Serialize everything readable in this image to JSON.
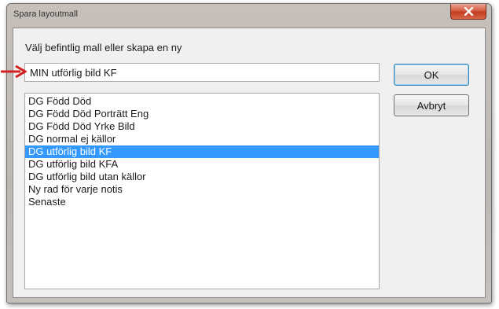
{
  "window": {
    "title": "Spara layoutmall"
  },
  "dialog": {
    "prompt": "Välj befintlig mall eller skapa en ny",
    "name_value": "MIN utförlig bild KF",
    "ok_label": "OK",
    "cancel_label": "Avbryt"
  },
  "templates": [
    {
      "label": "DG Född Död",
      "selected": false
    },
    {
      "label": "DG Född Död Porträtt Eng",
      "selected": false
    },
    {
      "label": "DG Född Död Yrke Bild",
      "selected": false
    },
    {
      "label": "DG normal ej källor",
      "selected": false
    },
    {
      "label": "DG utförlig bild KF",
      "selected": true
    },
    {
      "label": "DG utförlig bild KFA",
      "selected": false
    },
    {
      "label": "DG utförlig bild utan källor",
      "selected": false
    },
    {
      "label": "Ny rad för varje notis",
      "selected": false
    },
    {
      "label": "Senaste",
      "selected": false
    }
  ],
  "colors": {
    "selection": "#3399ff",
    "annotation_arrow": "#d42020",
    "close_button": "#c9442a"
  },
  "icons": {
    "close": "close-icon",
    "annotation": "red-arrow-icon"
  }
}
